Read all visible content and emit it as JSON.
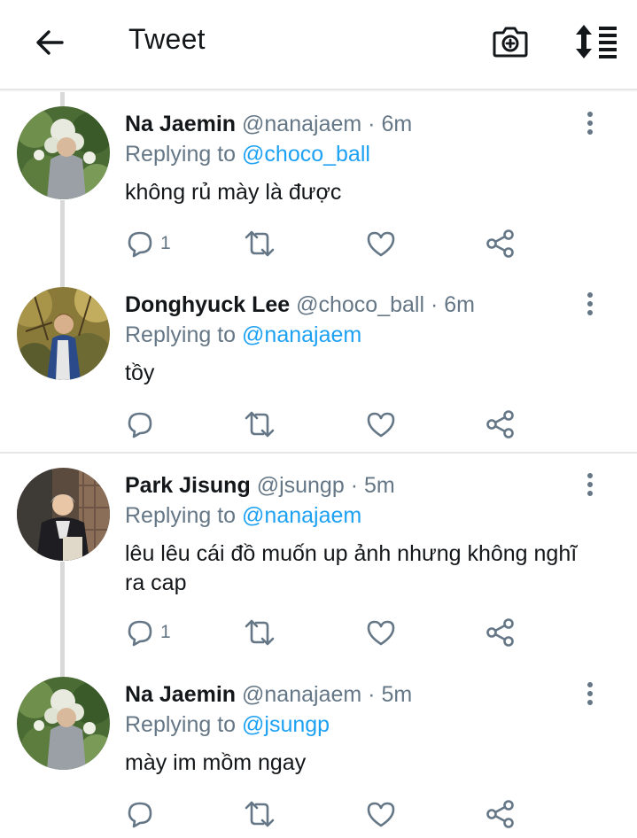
{
  "header": {
    "title": "Tweet",
    "back_icon": "arrow-left-icon",
    "camera_icon": "camera-plus-icon",
    "sort_icon": "sort-list-icon"
  },
  "colors": {
    "link": "#1da1f2",
    "secondary": "#657786",
    "text": "#14171a",
    "divider": "#e6e6e6",
    "thread_line": "#d9d9d9"
  },
  "tweets": [
    {
      "name": "Na Jaemin",
      "handle": "@nanajaem",
      "dot": "·",
      "time": "6m",
      "replying_label": "Replying to",
      "replying_to": "@choco_ball",
      "text": "không rủ mày là được",
      "reply_count": "1"
    },
    {
      "name": "Donghyuck Lee",
      "handle": "@choco_ball",
      "dot": "·",
      "time": "6m",
      "replying_label": "Replying to",
      "replying_to": "@nanajaem",
      "text": "tồy",
      "reply_count": ""
    },
    {
      "name": "Park Jisung",
      "handle": "@jsungp",
      "dot": "·",
      "time": "5m",
      "replying_label": "Replying to",
      "replying_to": "@nanajaem",
      "text": "lêu lêu cái đồ muốn up ảnh nhưng không nghĩ ra cap",
      "reply_count": "1"
    },
    {
      "name": "Na Jaemin",
      "handle": "@nanajaem",
      "dot": "·",
      "time": "5m",
      "replying_label": "Replying to",
      "replying_to": "@jsungp",
      "text": "mày im mồm ngay",
      "reply_count": ""
    }
  ]
}
